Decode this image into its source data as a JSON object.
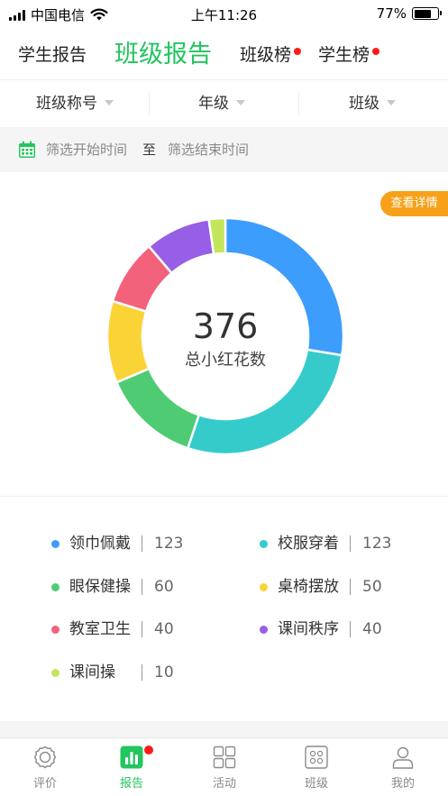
{
  "status_bar": {
    "carrier": "中国电信",
    "time": "上午11:26",
    "battery_text": "77%",
    "battery_level": 0.77
  },
  "top_tabs": [
    {
      "label": "学生报告",
      "active": false,
      "badge": false
    },
    {
      "label": "班级报告",
      "active": true,
      "badge": false
    },
    {
      "label": "班级榜",
      "active": false,
      "badge": true
    },
    {
      "label": "学生榜",
      "active": false,
      "badge": true
    }
  ],
  "filters": {
    "title_select": "班级称号",
    "grade_select": "年级",
    "class_select": "班级"
  },
  "date_range": {
    "start_placeholder": "筛选开始时间",
    "separator": "至",
    "end_placeholder": "筛选结束时间"
  },
  "detail_button": "查看详情",
  "chart_data": {
    "type": "pie",
    "donut": true,
    "center_value": "376",
    "center_label": "总小红花数",
    "total": 376,
    "series": [
      {
        "name": "领巾佩戴",
        "value": 123,
        "color": "#3d9dfc"
      },
      {
        "name": "校服穿着",
        "value": 123,
        "color": "#36cbcb"
      },
      {
        "name": "眼保健操",
        "value": 60,
        "color": "#4ecb73"
      },
      {
        "name": "桌椅摆放",
        "value": 50,
        "color": "#fad337"
      },
      {
        "name": "教室卫生",
        "value": 40,
        "color": "#f2637b"
      },
      {
        "name": "课间秩序",
        "value": 40,
        "color": "#975fe5"
      },
      {
        "name": "课间操",
        "value": 10,
        "color": "#c3e65b"
      }
    ]
  },
  "legend": [
    {
      "name": "领巾佩戴",
      "value": "123"
    },
    {
      "name": "校服穿着",
      "value": "123"
    },
    {
      "name": "眼保健操",
      "value": "60"
    },
    {
      "name": "桌椅摆放",
      "value": "50"
    },
    {
      "name": "教室卫生",
      "value": "40"
    },
    {
      "name": "课间秩序",
      "value": "40"
    },
    {
      "name": "课间操",
      "value": "10"
    }
  ],
  "bottom_nav": [
    {
      "label": "评价",
      "icon": "evaluate-icon",
      "active": false,
      "badge": false
    },
    {
      "label": "报告",
      "icon": "report-icon",
      "active": true,
      "badge": true
    },
    {
      "label": "活动",
      "icon": "activity-icon",
      "active": false,
      "badge": false
    },
    {
      "label": "班级",
      "icon": "class-icon",
      "active": false,
      "badge": false
    },
    {
      "label": "我的",
      "icon": "profile-icon",
      "active": false,
      "badge": false
    }
  ],
  "colors": {
    "accent": "#22c55e",
    "badge": "#ff1a1a",
    "detail_button": "#f7a11a"
  }
}
